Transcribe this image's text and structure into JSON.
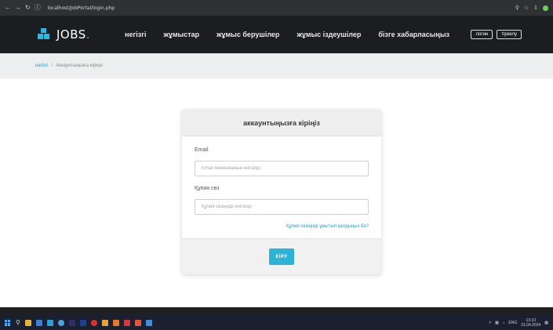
{
  "browser": {
    "back_icon": "arrow-left-icon",
    "forward_icon": "arrow-right-icon",
    "reload_icon": "reload-icon",
    "address": "localhost/JobPortal/login.php"
  },
  "header": {
    "logo": "JOBS",
    "logo_suffix": ".",
    "nav": [
      "негізгі",
      "жұмыстар",
      "жұмыс берушілер",
      "жұмыс іздеушілер",
      "бізге хабарласыңыз"
    ],
    "login_label": "логин",
    "register_label": "тіркелу",
    "accent": "#2bb7e0"
  },
  "breadcrumb": {
    "home": "негізгі",
    "separator": "/",
    "current": "Аккаунтыңызға кіріңіз"
  },
  "login_card": {
    "title": "аккаунтыңызға кіріңіз",
    "email_label": "Email",
    "email_placeholder": "Email мекенжайын енгізіңіз",
    "password_label": "Құпия сөз",
    "password_placeholder": "Құпия сөзіңізді енгізіңіз",
    "forgot_link": "Құпия сөзіңізді ұмытып қалдыңыз ба?",
    "submit_label": "КІРУ"
  },
  "taskbar": {
    "time": "13:10",
    "date": "21.04.2024"
  }
}
